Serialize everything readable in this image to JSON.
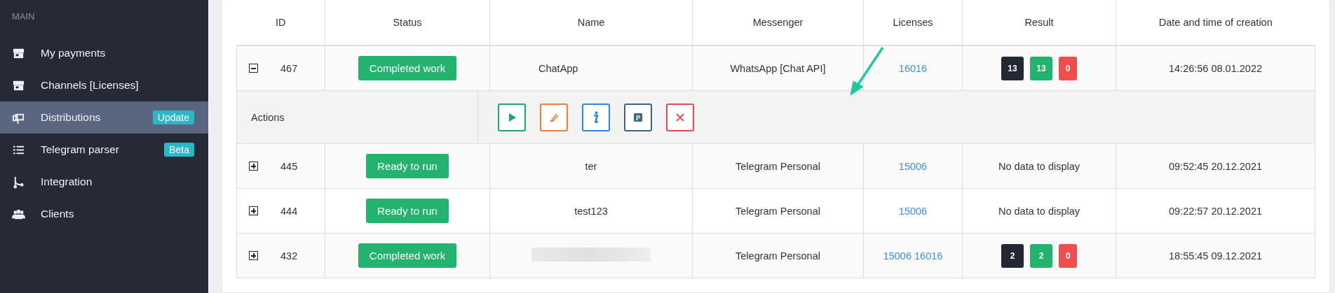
{
  "sidebar": {
    "section": "MAIN",
    "items": [
      {
        "label": "My payments",
        "kind": "store",
        "selected": false
      },
      {
        "label": "Channels [Licenses]",
        "kind": "store",
        "selected": false
      },
      {
        "label": "Distributions",
        "kind": "mailbox",
        "selected": true,
        "badge": "Update"
      },
      {
        "label": "Telegram parser",
        "kind": "list",
        "selected": false,
        "badge": "Beta"
      },
      {
        "label": "Integration",
        "kind": "branch",
        "selected": false
      },
      {
        "label": "Clients",
        "kind": "users",
        "selected": false
      }
    ]
  },
  "table": {
    "columns": [
      "ID",
      "Status",
      "Name",
      "Messenger",
      "Licenses",
      "Result",
      "Date and time of creation"
    ],
    "rows": [
      {
        "id": "467",
        "expanded": true,
        "status": "Completed work",
        "name": "ChatApp",
        "redacted": false,
        "messenger": "WhatsApp [Chat API]",
        "licenses": "16016",
        "results": [
          {
            "value": "13",
            "kind": "total"
          },
          {
            "value": "13",
            "kind": "success"
          },
          {
            "value": "0",
            "kind": "error"
          }
        ],
        "created": "14:26:56 08.01.2022"
      },
      {
        "id": "445",
        "expanded": false,
        "status": "Ready to run",
        "name": "ter",
        "redacted": false,
        "messenger": "Telegram Personal",
        "licenses": "15006",
        "result_text": "No data to display",
        "created": "09:52:45 20.12.2021"
      },
      {
        "id": "444",
        "expanded": false,
        "status": "Ready to run",
        "name": "test123",
        "redacted": false,
        "messenger": "Telegram Personal",
        "licenses": "15006",
        "result_text": "No data to display",
        "created": "09:22:57 20.12.2021"
      },
      {
        "id": "432",
        "expanded": false,
        "status": "Completed work",
        "redacted": true,
        "messenger": "Telegram Personal",
        "licenses": "15006 16016",
        "results": [
          {
            "value": "2",
            "kind": "total"
          },
          {
            "value": "2",
            "kind": "success"
          },
          {
            "value": "0",
            "kind": "error"
          }
        ],
        "created": "18:55:45 09.12.2021"
      }
    ],
    "actions": {
      "label": "Actions",
      "buttons": [
        {
          "kind": "play",
          "color": "#22a866"
        },
        {
          "kind": "edit",
          "color": "#f57c3a"
        },
        {
          "kind": "info",
          "color": "#2f86e6"
        },
        {
          "kind": "report",
          "color": "#3d6480"
        },
        {
          "kind": "delete",
          "color": "#e84b4b"
        }
      ]
    }
  }
}
